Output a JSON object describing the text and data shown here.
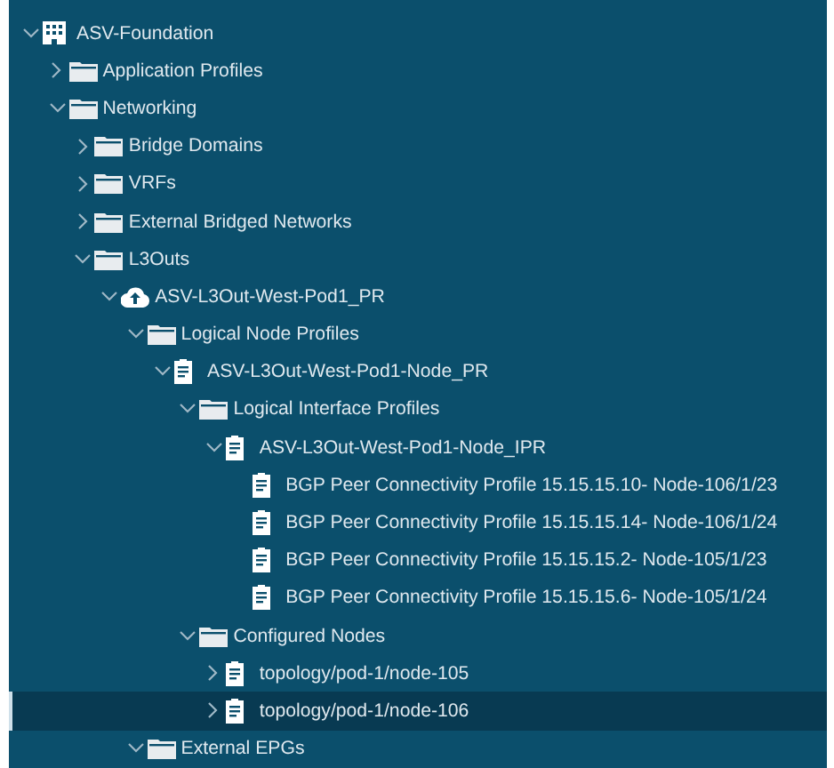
{
  "tree": [
    {
      "label": "ASV-Foundation",
      "kind": "tenant",
      "expanded": true,
      "selected": false,
      "children": [
        {
          "label": "Application Profiles",
          "kind": "folder",
          "expanded": false,
          "selected": false
        },
        {
          "label": "Networking",
          "kind": "folder",
          "expanded": true,
          "selected": false,
          "children": [
            {
              "label": "Bridge Domains",
              "kind": "folder",
              "expanded": false,
              "selected": false
            },
            {
              "label": "VRFs",
              "kind": "folder",
              "expanded": false,
              "selected": false
            },
            {
              "label": "External Bridged Networks",
              "kind": "folder",
              "expanded": false,
              "selected": false
            },
            {
              "label": "L3Outs",
              "kind": "folder",
              "expanded": true,
              "selected": false,
              "children": [
                {
                  "label": "ASV-L3Out-West-Pod1_PR",
                  "kind": "cloud",
                  "expanded": true,
                  "selected": false,
                  "children": [
                    {
                      "label": "Logical Node Profiles",
                      "kind": "folder",
                      "expanded": true,
                      "selected": false,
                      "children": [
                        {
                          "label": "ASV-L3Out-West-Pod1-Node_PR",
                          "kind": "doc",
                          "expanded": true,
                          "selected": false,
                          "children": [
                            {
                              "label": "Logical Interface Profiles",
                              "kind": "folder",
                              "expanded": true,
                              "selected": false,
                              "children": [
                                {
                                  "label": "ASV-L3Out-West-Pod1-Node_IPR",
                                  "kind": "doc",
                                  "expanded": true,
                                  "selected": false,
                                  "children": [
                                    {
                                      "label": "BGP Peer Connectivity Profile 15.15.15.10- Node-106/1/23",
                                      "kind": "doc",
                                      "selected": false
                                    },
                                    {
                                      "label": "BGP Peer Connectivity Profile 15.15.15.14- Node-106/1/24",
                                      "kind": "doc",
                                      "selected": false
                                    },
                                    {
                                      "label": "BGP Peer Connectivity Profile 15.15.15.2- Node-105/1/23",
                                      "kind": "doc",
                                      "selected": false
                                    },
                                    {
                                      "label": "BGP Peer Connectivity Profile 15.15.15.6- Node-105/1/24",
                                      "kind": "doc",
                                      "selected": false
                                    }
                                  ]
                                }
                              ]
                            },
                            {
                              "label": "Configured Nodes",
                              "kind": "folder",
                              "expanded": true,
                              "selected": false,
                              "children": [
                                {
                                  "label": "topology/pod-1/node-105",
                                  "kind": "doc",
                                  "expanded": false,
                                  "selected": false
                                },
                                {
                                  "label": "topology/pod-1/node-106",
                                  "kind": "doc",
                                  "expanded": false,
                                  "selected": true
                                }
                              ]
                            }
                          ]
                        }
                      ]
                    },
                    {
                      "label": "External EPGs",
                      "kind": "folder",
                      "expanded": true,
                      "selected": false
                    }
                  ]
                }
              ]
            }
          ]
        }
      ]
    }
  ]
}
